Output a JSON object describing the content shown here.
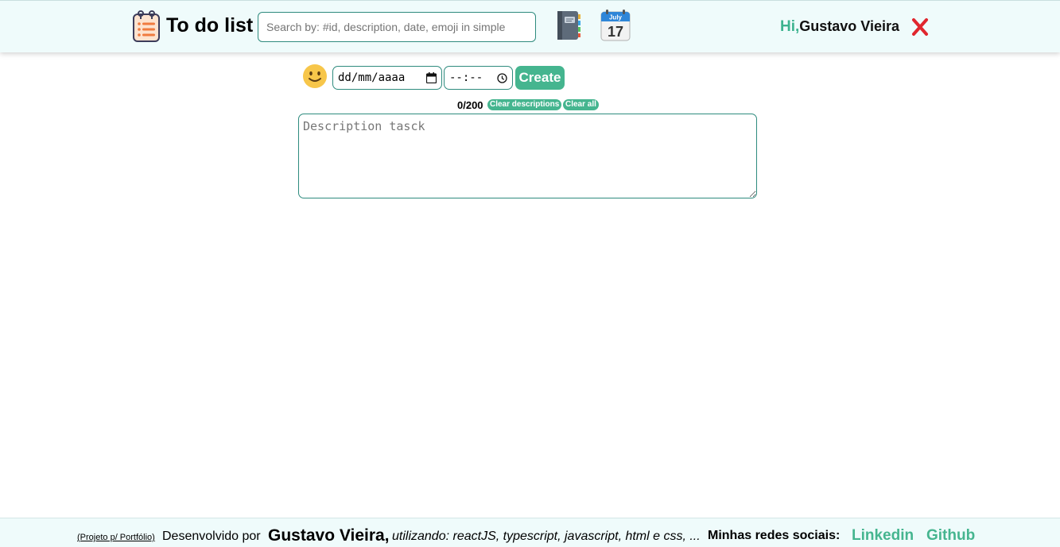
{
  "header": {
    "logo_icon": "notepad-list-icon",
    "title": "To do list",
    "search_placeholder": "Search by: #id, description, date, emoji in simple",
    "notebook_icon": "notebook-icon",
    "calendar": {
      "icon": "calendar-icon",
      "month": "July",
      "day": "17"
    },
    "greeting_hi": "Hi,",
    "user_name": "Gustavo Vieira",
    "close_icon": "red-x-icon"
  },
  "form": {
    "emoji_icon": "slightly-smiling-face-icon",
    "date_value": "dd/mm/aaaa",
    "time_value": "--:--",
    "create_label": "Create",
    "counter": "0/200",
    "clear_descriptions_label": "Clear descriptions",
    "clear_all_label": "Clear all",
    "description_placeholder": "Description tasck"
  },
  "footer": {
    "portfolio": "(Projeto p/ Portfólio)",
    "developed_by": "Desenvolvido por",
    "author": "Gustavo Vieira,",
    "tech": "utilizando: reactJS, typescript, javascript, html e css, ...",
    "social_label": "Minhas redes sociais:",
    "linkedin": "Linkedin",
    "github": "Github"
  },
  "colors": {
    "accent": "#45b58f",
    "header_bg": "#effbfb",
    "border": "#2e8b7e",
    "close": "#e0262e"
  }
}
